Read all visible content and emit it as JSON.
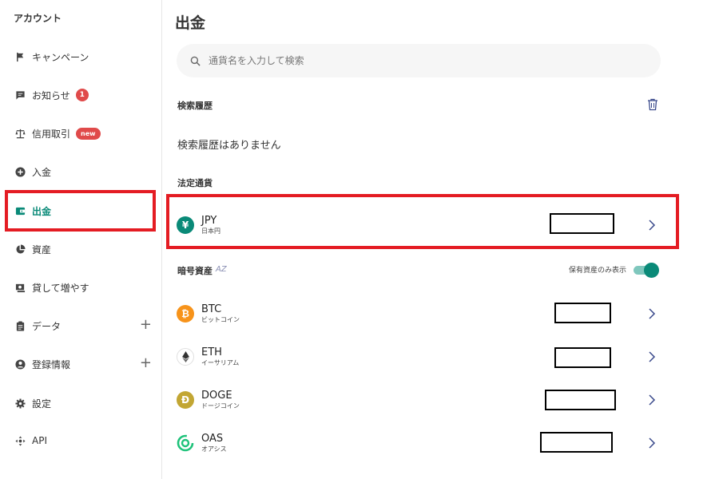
{
  "sidebar": {
    "title": "アカウント",
    "items": [
      {
        "label": "キャンペーン",
        "icon": "flag-icon"
      },
      {
        "label": "お知らせ",
        "icon": "message-icon",
        "badge": "1"
      },
      {
        "label": "信用取引",
        "icon": "scale-icon",
        "badge": "new"
      },
      {
        "label": "入金",
        "icon": "plus-circle-icon"
      },
      {
        "label": "出金",
        "icon": "wallet-icon",
        "active": true
      },
      {
        "label": "資産",
        "icon": "pie-chart-icon"
      },
      {
        "label": "貸して増やす",
        "icon": "lend-icon"
      },
      {
        "label": "データ",
        "icon": "clipboard-icon",
        "expand": "+"
      },
      {
        "label": "登録情報",
        "icon": "user-icon",
        "expand": "+"
      },
      {
        "label": "設定",
        "icon": "gear-icon"
      },
      {
        "label": "API",
        "icon": "api-icon"
      }
    ]
  },
  "main": {
    "title": "出金",
    "search_placeholder": "通貨名を入力して検索",
    "history": {
      "label": "検索履歴",
      "empty_text": "検索履歴はありません"
    },
    "fiat": {
      "label": "法定通貨",
      "items": [
        {
          "symbol": "JPY",
          "name": "日本円",
          "icon_glyph": "¥",
          "color": "#0a8a78"
        }
      ]
    },
    "crypto": {
      "label": "暗号資産",
      "sort_label": "AZ",
      "toggle_label": "保有資産のみ表示",
      "toggle_on": true,
      "items": [
        {
          "symbol": "BTC",
          "name": "ビットコイン",
          "icon_glyph": "₿",
          "color": "#f7931a"
        },
        {
          "symbol": "ETH",
          "name": "イーサリアム",
          "icon_glyph": "◆",
          "color": "#ffffff"
        },
        {
          "symbol": "DOGE",
          "name": "ドージコイン",
          "icon_glyph": "Đ",
          "color": "#c2a633"
        },
        {
          "symbol": "OAS",
          "name": "オアシス",
          "icon_glyph": "⊚",
          "color": "#ffffff"
        }
      ]
    }
  },
  "colors": {
    "accent": "#0a8a78",
    "highlight": "#e41c23",
    "badge": "#e04a4a",
    "chevron": "#3a4a8c"
  }
}
